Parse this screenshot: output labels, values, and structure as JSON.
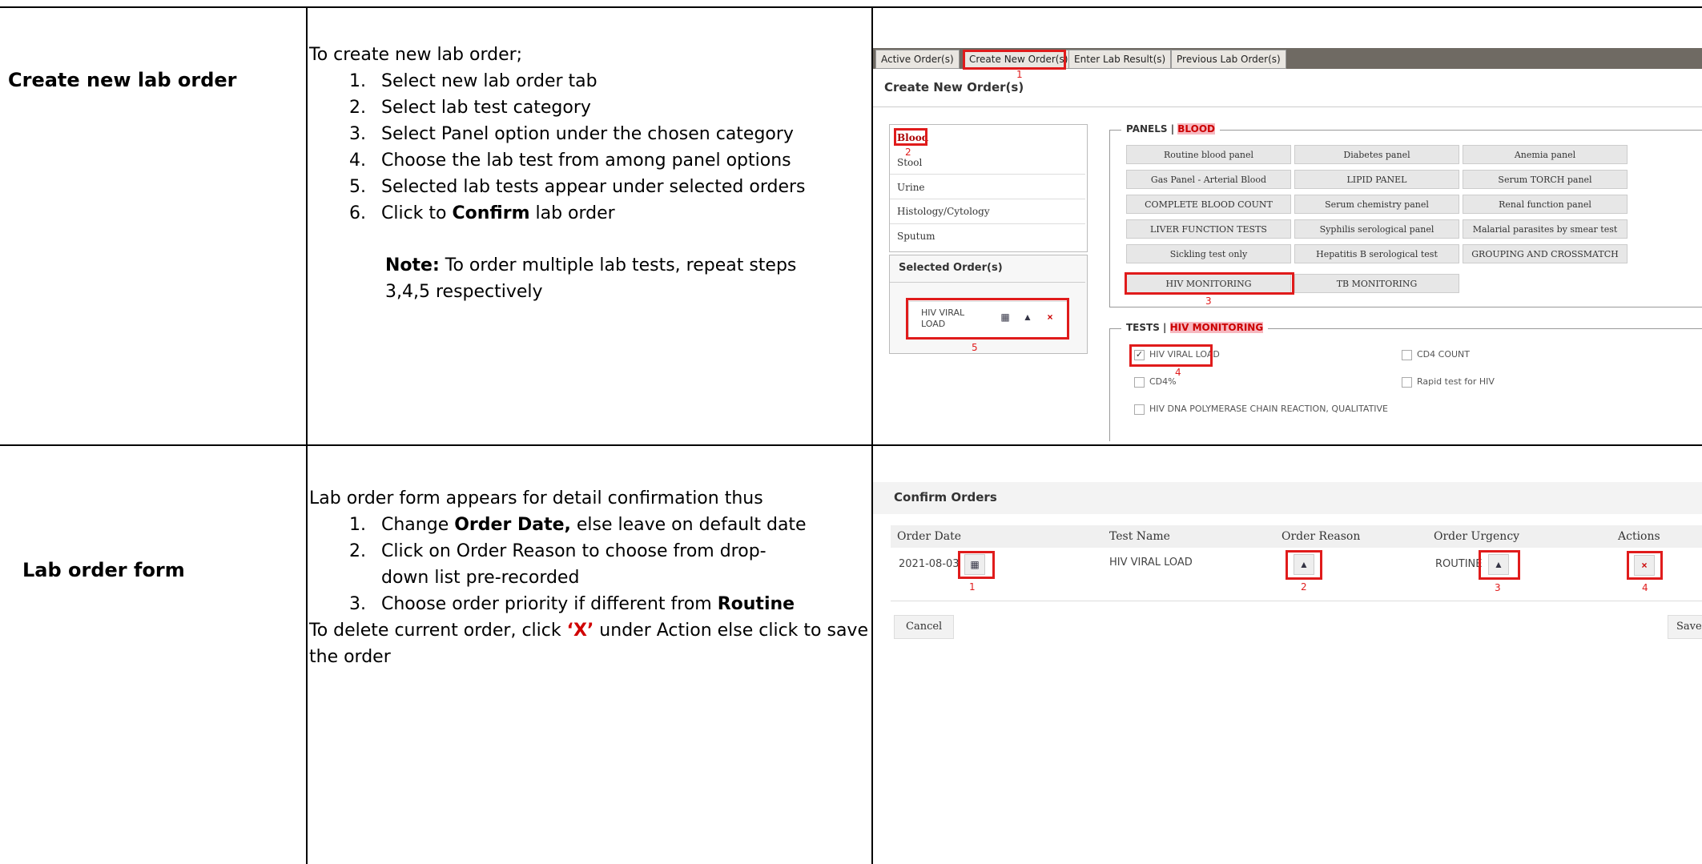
{
  "row1": {
    "title": "Create new lab order",
    "intro": "To create new lab order;",
    "steps": [
      "Select new lab order tab",
      "Select lab test category",
      "Select Panel option under the chosen category",
      "Choose the lab test from among panel options",
      "Selected lab tests appear under selected orders"
    ],
    "step6_pre": "Click to ",
    "step6_bold": "Confirm",
    "step6_post": " lab order",
    "note_label": "Note:",
    "note_text": " To order multiple lab tests, repeat steps 3,4,5 respectively"
  },
  "row2": {
    "title": "Lab order form",
    "intro": "Lab order form appears for detail confirmation thus",
    "s1_pre": "Change ",
    "s1_bold": "Order Date,",
    "s1_post": " else leave on default date",
    "s2": "Click on Order Reason to choose from drop-down list pre-recorded",
    "s3_pre": "Choose order priority if different from ",
    "s3_bold": "Routine",
    "del_pre": "To delete current order, click ",
    "del_x": "‘X’",
    "del_post": " under Action else click to save the order"
  },
  "shot1": {
    "tabs": [
      "Active Order(s)",
      "Create New Order(s)",
      "Enter Lab Result(s)",
      "Previous Lab Order(s)"
    ],
    "heading": "Create New Order(s)",
    "categories": [
      "Blood",
      "Stool",
      "Urine",
      "Histology/Cytology",
      "Sputum"
    ],
    "selected_heading": "Selected Order(s)",
    "selected_item": "HIV VIRAL LOAD",
    "panels_label": "PANELS | ",
    "panels_cat": "BLOOD",
    "panels": [
      "Routine blood panel",
      "Diabetes panel",
      "Anemia panel",
      "Gas Panel - Arterial Blood",
      "LIPID PANEL",
      "Serum TORCH panel",
      "COMPLETE BLOOD COUNT",
      "Serum chemistry panel",
      "Renal function panel",
      "LIVER FUNCTION TESTS",
      "Syphilis serological panel",
      "Malarial parasites by smear test",
      "Sickling test only",
      "Hepatitis B serological test",
      "GROUPING AND CROSSMATCH",
      "HIV MONITORING",
      "TB MONITORING"
    ],
    "tests_label": "TESTS | ",
    "tests_panel": "HIV MONITORING",
    "tests": [
      "HIV VIRAL LOAD",
      "CD4 COUNT",
      "CD4%",
      "Rapid test for HIV",
      "HIV DNA POLYMERASE CHAIN REACTION, QUALITATIVE"
    ],
    "marks": [
      "1",
      "2",
      "3",
      "4",
      "5"
    ]
  },
  "shot2": {
    "heading": "Confirm Orders",
    "headers": [
      "Order Date",
      "Test Name",
      "Order Reason",
      "Order Urgency",
      "Actions"
    ],
    "date": "2021-08-03",
    "test": "HIV VIRAL LOAD",
    "urgency": "ROUTINE",
    "cancel": "Cancel",
    "save": "Save",
    "marks": [
      "1",
      "2",
      "3",
      "4"
    ]
  }
}
